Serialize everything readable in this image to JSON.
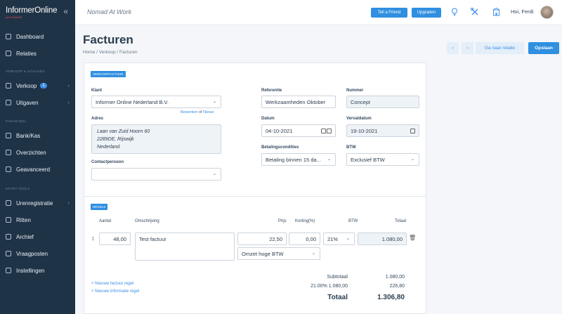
{
  "app": {
    "logo": "InformerOnline",
    "logo_sub": "ad E-RANGE",
    "company": "Nomad At Work",
    "greeting": "Hoi, Ferdi"
  },
  "topbar": {
    "tell_friend": "Tell a Friend",
    "upgrade": "Upgraden"
  },
  "sidebar": {
    "items_top": [
      {
        "label": "Dashboard",
        "icon": "dashboard-icon"
      },
      {
        "label": "Relaties",
        "icon": "contacts-icon"
      }
    ],
    "section1": "VERKOOP & UITGAVEN",
    "items_sales": [
      {
        "label": "Verkoop",
        "badge": "1",
        "icon": "sales-icon"
      },
      {
        "label": "Uitgaven",
        "icon": "expenses-icon"
      }
    ],
    "section2": "FINANCIEEL",
    "items_fin": [
      {
        "label": "Bank/Kas",
        "icon": "bank-icon"
      },
      {
        "label": "Overzichten",
        "icon": "chart-icon"
      },
      {
        "label": "Geavanceerd",
        "icon": "advanced-icon"
      }
    ],
    "section3": "EXTRA TOOLS",
    "items_tools": [
      {
        "label": "Urenregistratie",
        "icon": "clock-icon"
      },
      {
        "label": "Ritten",
        "icon": "car-icon"
      },
      {
        "label": "Archief",
        "icon": "archive-icon"
      },
      {
        "label": "Vraagposten",
        "icon": "question-icon"
      },
      {
        "label": "Instellingen",
        "icon": "settings-icon"
      }
    ]
  },
  "page": {
    "title": "Facturen",
    "breadcrumb": "Home / Verkoop / Facturen",
    "prev": "‹",
    "next": "›",
    "goto": "Ga naar relatie",
    "save": "Opslaan"
  },
  "invoice": {
    "tag": "VERKOOPFACTUUR",
    "klant_label": "Klant",
    "klant_value": "Informer Online Nederland B.V.",
    "bewerken": "Bewerken",
    "of": "of",
    "nieuw": "Nieuw",
    "adres_label": "Adres",
    "adres_line1": "Laan van Zuid Hoorn 60",
    "adres_line2": "2289DE, Rijswijk",
    "adres_line3": "Nederland",
    "contact_label": "Contactpersoon",
    "contact_value": "",
    "referentie_label": "Referentie",
    "referentie_value": "Werkzaamheden Oktober",
    "nummer_label": "Nummer",
    "nummer_value": "Concept",
    "datum_label": "Datum",
    "datum_value": "04-10-2021",
    "vervaldatum_label": "Vervaldatum",
    "vervaldatum_value": "19-10-2021",
    "betaal_label": "Betalingscondities",
    "betaal_value": "Betaling binnen 15 da...",
    "btw_label": "BTW",
    "btw_value": "Exclusief BTW"
  },
  "lines": {
    "tag": "REGELS",
    "headers": {
      "aantal": "Aantal",
      "omschrijving": "Omschrijving",
      "prijs": "Prijs",
      "korting": "Korting(%)",
      "btw": "BTW",
      "totaal": "Totaal"
    },
    "rows": [
      {
        "aantal": "48,00",
        "omschrijving": "Test factuur",
        "prijs": "22,50",
        "korting": "0,00",
        "btw": "21%",
        "totaal": "1.080,00",
        "ledger": "Omzet hoge BTW"
      }
    ],
    "new_line": "+ Nieuwe factuur regel",
    "new_info": "+ Nieuwe informatie regel"
  },
  "totals": {
    "subtotaal_label": "Subtotaal",
    "subtotaal_value": "1.080,00",
    "vat_label": "21.00% 1.080,00",
    "vat_value": "226,80",
    "totaal_label": "Totaal",
    "totaal_value": "1.306,80"
  }
}
